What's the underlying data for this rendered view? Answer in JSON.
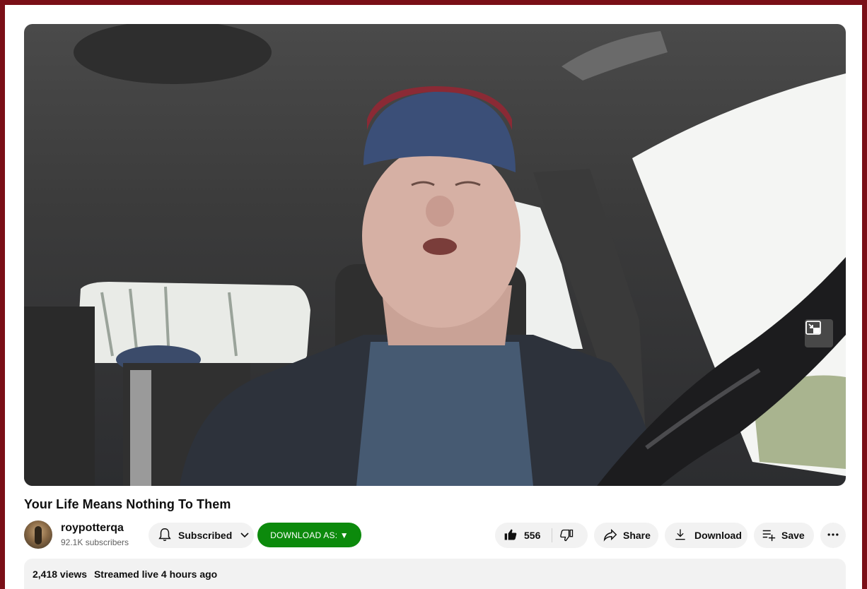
{
  "video": {
    "title": "Your Life Means Nothing To Them",
    "scene": "man-driving-in-car",
    "miniplayer_icon": "miniplayer-icon"
  },
  "channel": {
    "name": "roypotterqa",
    "subscribers": "92.1K subscribers"
  },
  "actions": {
    "subscribed_label": "Subscribed",
    "download_as_label": "DOWNLOAD AS: ▼",
    "like_count": "556",
    "share_label": "Share",
    "download_label": "Download",
    "save_label": "Save"
  },
  "description": {
    "views": "2,418 views",
    "streamed": "Streamed live 4 hours ago"
  },
  "colors": {
    "frame": "#7a0f17",
    "download_as_bg": "#0c8a0c",
    "pill_bg": "#f2f2f2"
  }
}
